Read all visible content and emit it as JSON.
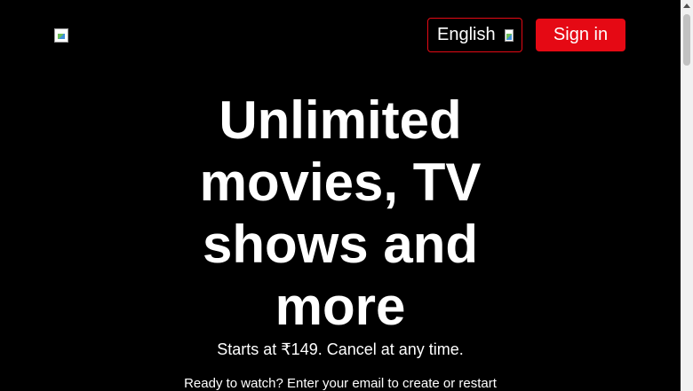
{
  "header": {
    "logo_icon": "broken-image-icon",
    "language_label": "English",
    "language_icon": "broken-image-icon",
    "signin_label": "Sign in"
  },
  "hero": {
    "title": "Unlimited movies, TV shows and more",
    "subtitle": "Starts at ₹149. Cancel at any time.",
    "cta_text": "Ready to watch? Enter your email to create or restart"
  },
  "colors": {
    "background": "#000000",
    "accent": "#e50914",
    "text": "#ffffff"
  }
}
